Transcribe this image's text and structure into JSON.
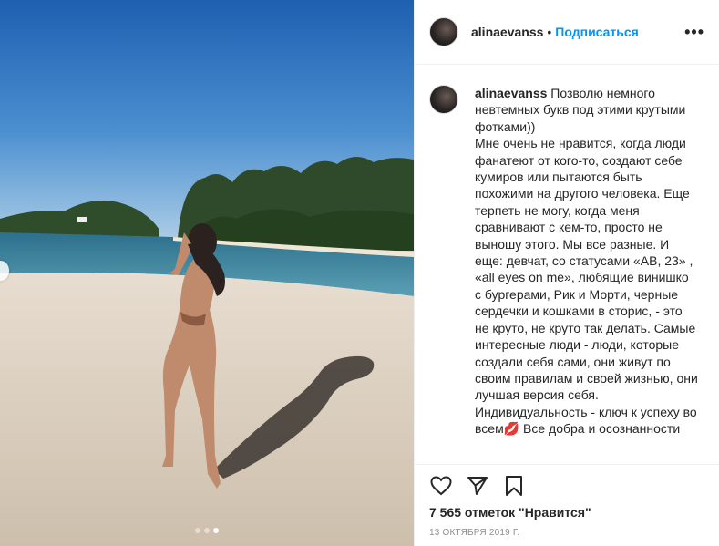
{
  "post": {
    "username": "alinaevanss",
    "header_separator": "•",
    "follow_label": "Подписаться",
    "more_label": "•••"
  },
  "caption": {
    "username": "alinaevanss",
    "text": "Позволю немного невтемных букв под этими крутыми фотками))\nМне очень не нравится, когда люди фанатеют от кого-то, создают себе кумиров или пытаются быть похожими на другого человека. Еще терпеть не могу, когда меня сравнивают с кем-то, просто не выношу этого. Мы все разные. И еще: девчат, со статусами «АВ, 23» , «all eyes on me», любящие винишко с бургерами, Рик и Морти, черные сердечки и кошками в сторис, - это не круто, не круто так делать. Самые интересные люди - люди, которые создали себя сами, они живут по своим правилам и своей жизнью, они лучшая версия себя. Индивидуальность - ключ к успеху во всем💋 Все добра и осознанности"
  },
  "actions": {
    "like_icon": "heart-icon",
    "share_icon": "paper-plane-icon",
    "save_icon": "bookmark-icon"
  },
  "likes_text": "7 565 отметок \"Нравится\"",
  "date_text": "13 октября 2019 г.",
  "carousel": {
    "total": 3,
    "active_index": 2
  }
}
